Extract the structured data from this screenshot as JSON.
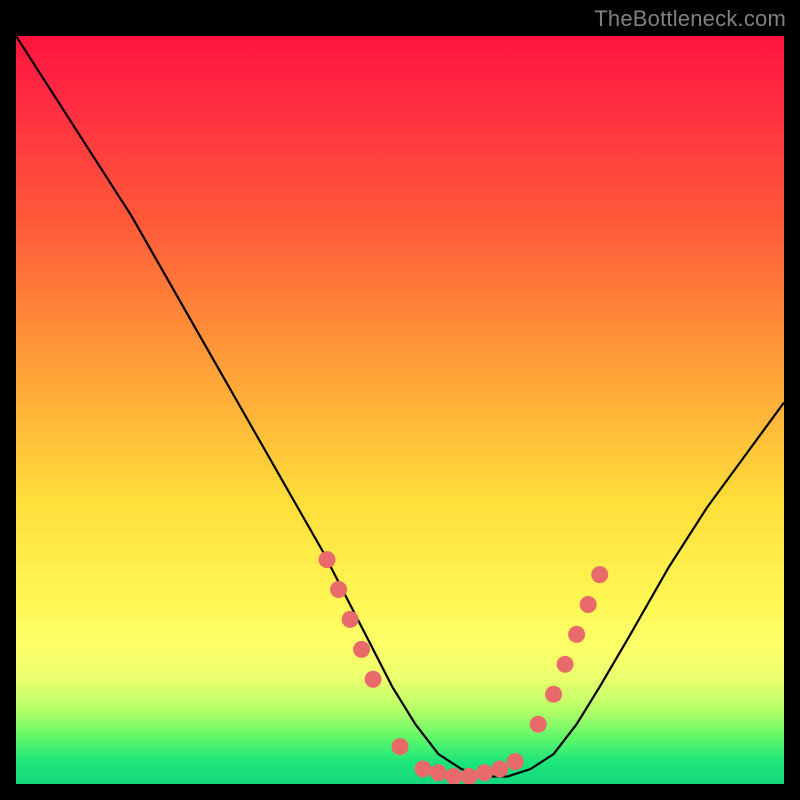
{
  "watermark": {
    "text": "TheBottleneck.com"
  },
  "colors": {
    "background": "#000000",
    "curve": "#000000",
    "dots": "#e96a6a",
    "gradient_top": "#ff143f",
    "gradient_mid": "#ffdd3a",
    "gradient_bottom": "#14d87f"
  },
  "chart_data": {
    "type": "line",
    "title": "",
    "xlabel": "",
    "ylabel": "",
    "xlim": [
      0,
      100
    ],
    "ylim": [
      0,
      100
    ],
    "series": [
      {
        "name": "curve",
        "x": [
          0,
          5,
          10,
          15,
          20,
          25,
          30,
          35,
          40,
          43,
          46,
          49,
          52,
          55,
          58,
          61,
          64,
          67,
          70,
          73,
          76,
          80,
          85,
          90,
          95,
          100
        ],
        "y": [
          100,
          92,
          84,
          76,
          67,
          58,
          49,
          40,
          31,
          25,
          19,
          13,
          8,
          4,
          2,
          1,
          1,
          2,
          4,
          8,
          13,
          20,
          29,
          37,
          44,
          51
        ]
      }
    ],
    "markers": [
      {
        "x": 40.5,
        "y": 30
      },
      {
        "x": 42.0,
        "y": 26
      },
      {
        "x": 43.5,
        "y": 22
      },
      {
        "x": 45.0,
        "y": 18
      },
      {
        "x": 46.5,
        "y": 14
      },
      {
        "x": 50.0,
        "y": 5
      },
      {
        "x": 53.0,
        "y": 2
      },
      {
        "x": 55.0,
        "y": 1.5
      },
      {
        "x": 57.0,
        "y": 1
      },
      {
        "x": 59.0,
        "y": 1
      },
      {
        "x": 61.0,
        "y": 1.5
      },
      {
        "x": 63.0,
        "y": 2
      },
      {
        "x": 65.0,
        "y": 3
      },
      {
        "x": 68.0,
        "y": 8
      },
      {
        "x": 70.0,
        "y": 12
      },
      {
        "x": 71.5,
        "y": 16
      },
      {
        "x": 73.0,
        "y": 20
      },
      {
        "x": 74.5,
        "y": 24
      },
      {
        "x": 76.0,
        "y": 28
      }
    ]
  }
}
